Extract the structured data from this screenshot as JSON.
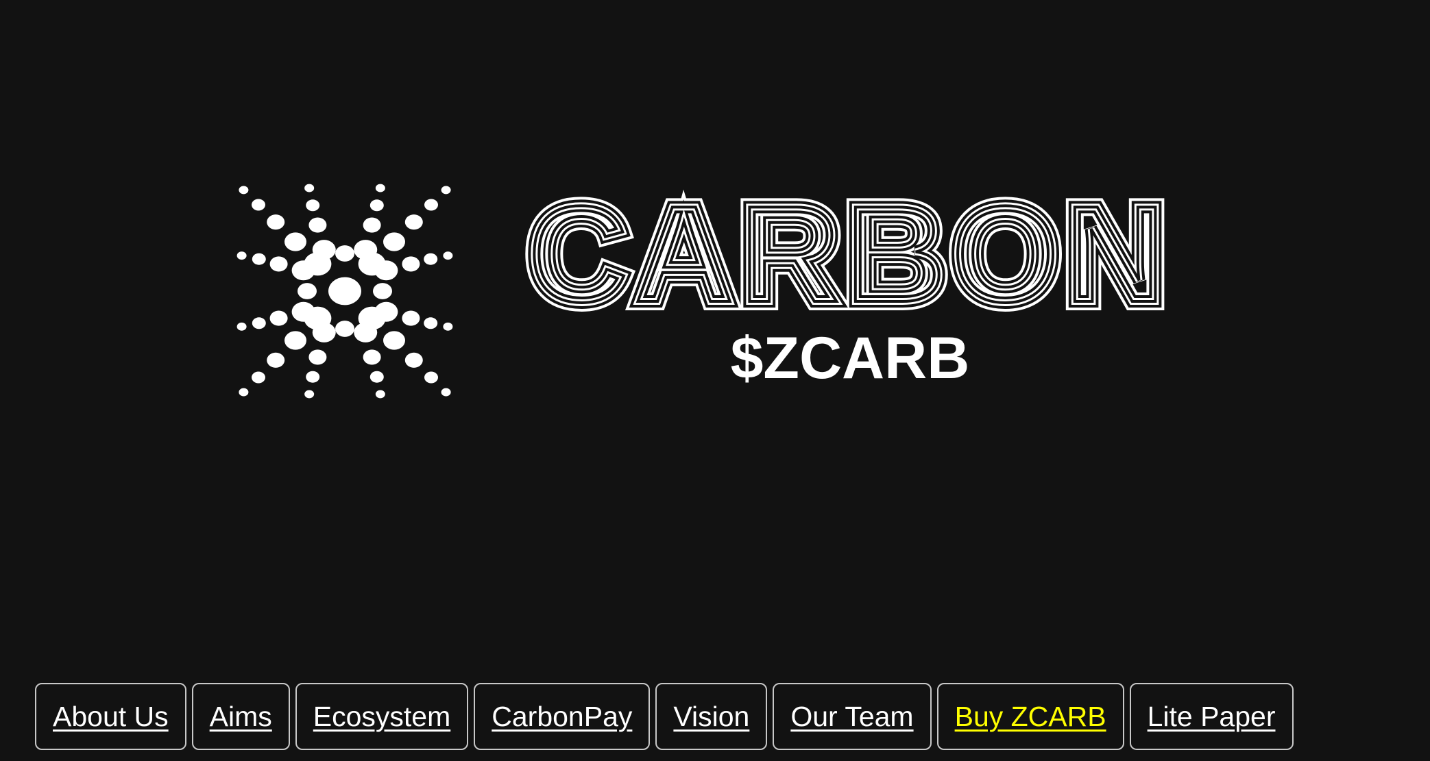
{
  "logo": {
    "title": "CARBON",
    "ticker": "$ZCARB",
    "icon": "x-dots-logo-icon",
    "color": "#ffffff",
    "background": "#121212"
  },
  "nav": {
    "items": [
      {
        "label": "About Us"
      },
      {
        "label": "Aims"
      },
      {
        "label": "Ecosystem"
      },
      {
        "label": "CarbonPay"
      },
      {
        "label": "Vision"
      },
      {
        "label": "Our Team"
      },
      {
        "label": "Buy ZCARB",
        "highlight": true,
        "color": "#ffff00"
      },
      {
        "label": "Lite Paper"
      }
    ],
    "border_color": "#c8c8c8"
  }
}
